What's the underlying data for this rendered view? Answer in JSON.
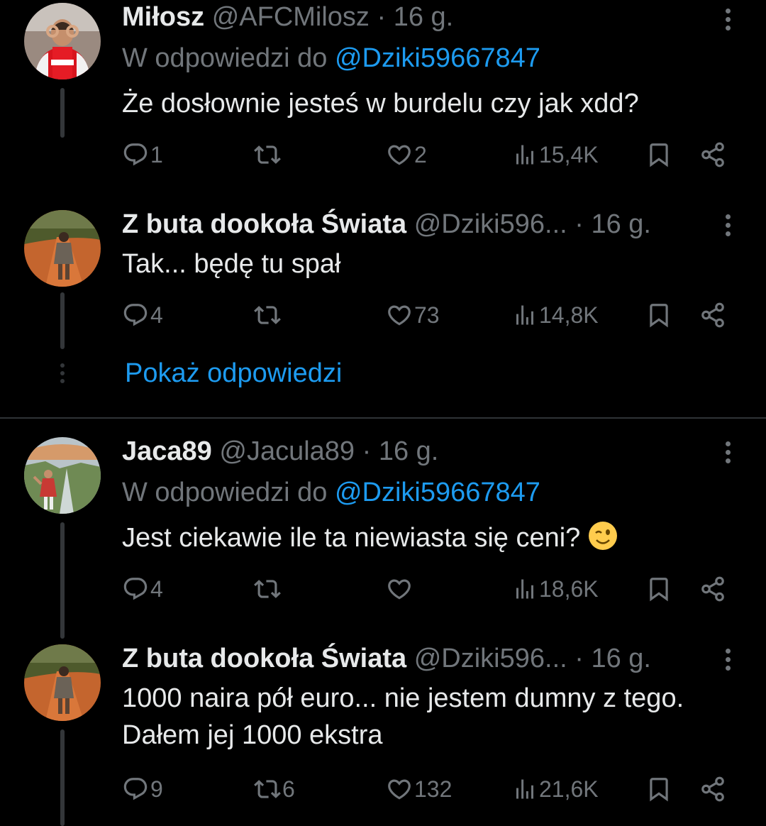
{
  "tweets": [
    {
      "name": "Miłosz",
      "handle": "@AFCMilosz",
      "time": "· 16 g.",
      "reply_prefix": "W odpowiedzi do",
      "reply_mention": "@Dziki59667847",
      "text": "Że dosłownie jesteś w burdelu czy jak xdd?",
      "replies": "1",
      "retweets": "",
      "likes": "2",
      "views": "15,4K",
      "avatar_icon": "arsenal-player-avatar"
    },
    {
      "name": "Z buta dookoła Świata",
      "handle": "@Dziki596...",
      "time": "· 16 g.",
      "text": "Tak... będę tu spał",
      "replies": "4",
      "retweets": "",
      "likes": "73",
      "views": "14,8K",
      "avatar_icon": "traveler-road-avatar"
    },
    {
      "name": "Jaca89",
      "handle": "@Jacula89",
      "time": "· 16 g.",
      "reply_prefix": "W odpowiedzi do",
      "reply_mention": "@Dziki59667847",
      "text": "Jest ciekawie ile ta niewiasta się ceni?",
      "text_emoji": "winking-face-emoji",
      "replies": "4",
      "retweets": "",
      "likes": "",
      "views": "18,6K",
      "avatar_icon": "canyon-avatar"
    },
    {
      "name": "Z buta dookoła Świata",
      "handle": "@Dziki596...",
      "time": "· 16 g.",
      "text_lines": [
        "1000 naira pół euro... nie jestem dumny z tego.",
        "Dałem jej 1000 ekstra"
      ],
      "replies": "9",
      "retweets": "6",
      "likes": "132",
      "views": "21,6K",
      "avatar_icon": "traveler-road-avatar"
    }
  ],
  "show_replies_label": "Pokaż odpowiedzi",
  "colors": {
    "background": "#000000",
    "text": "#e7e9ea",
    "muted": "#71767b",
    "link": "#1d9bf0",
    "divider": "#2f3336"
  }
}
